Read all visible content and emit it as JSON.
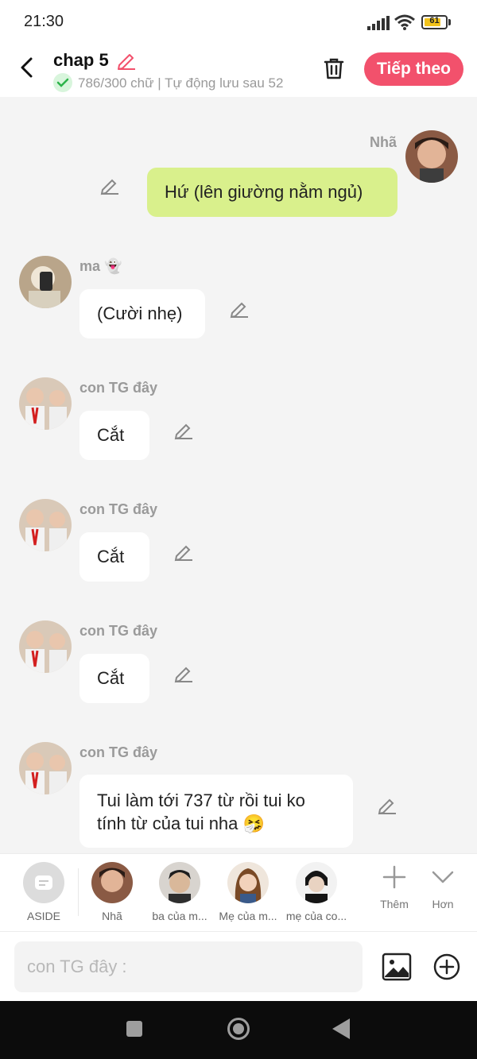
{
  "status_bar": {
    "time": "21:30",
    "battery": "61"
  },
  "header": {
    "title": "chap 5",
    "subtitle": "786/300 chữ | Tự động lưu sau 52",
    "next_label": "Tiếp theo"
  },
  "messages": [
    {
      "sender": "Nhã",
      "text": "Hứ (lên giường nằm ngủ)",
      "side": "right"
    },
    {
      "sender": "ma 👻",
      "text": "(Cười nhẹ)",
      "side": "left"
    },
    {
      "sender": "con TG đây",
      "text": "Cắt",
      "side": "left"
    },
    {
      "sender": "con TG đây",
      "text": "Cắt",
      "side": "left"
    },
    {
      "sender": "con TG đây",
      "text": "Cắt",
      "side": "left"
    },
    {
      "sender": "con TG đây",
      "text": "Tui làm tới 737 từ rồi tui ko tính từ của tui nha 🤧",
      "side": "left"
    }
  ],
  "characters": [
    {
      "label": "ASIDE"
    },
    {
      "label": "Nhã"
    },
    {
      "label": "ba của m..."
    },
    {
      "label": "Mẹ của m..."
    },
    {
      "label": "mẹ của co..."
    }
  ],
  "tools": {
    "more_label": "Thêm",
    "expand_label": "Hơn"
  },
  "input": {
    "placeholder": "con TG đây :"
  },
  "colors": {
    "accent": "#f2516c",
    "my_bubble": "#d9f08c",
    "background": "#f4f4f4"
  }
}
